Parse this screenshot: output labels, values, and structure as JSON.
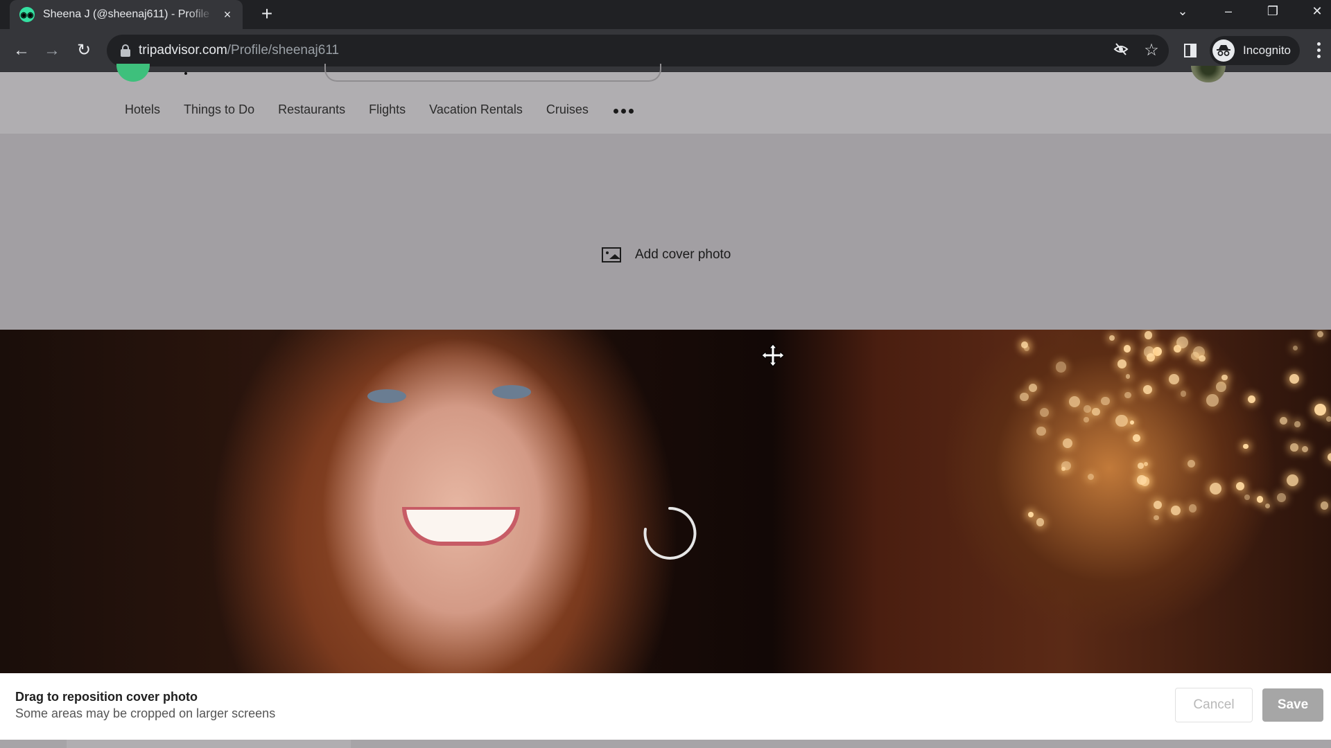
{
  "browser": {
    "tab": {
      "title": "Sheena J (@sheenaj611) - Profile",
      "favicon": "tripadvisor-owl-icon",
      "close_label": "×"
    },
    "new_tab_label": "+",
    "window_controls": {
      "tab_search": "⌄",
      "minimize": "–",
      "restore": "❐",
      "close": "✕"
    },
    "nav": {
      "back": "←",
      "forward": "→",
      "reload": "↻"
    },
    "url": {
      "domain": "tripadvisor.com",
      "path": "/Profile/sheenaj611"
    },
    "omnibox_icons": {
      "tracking_protection": "eye-off-icon",
      "bookmark": "☆"
    },
    "incognito_label": "Incognito"
  },
  "site": {
    "nav_links": [
      {
        "label": "Hotels"
      },
      {
        "label": "Things to Do"
      },
      {
        "label": "Restaurants"
      },
      {
        "label": "Flights"
      },
      {
        "label": "Vacation Rentals"
      },
      {
        "label": "Cruises"
      }
    ],
    "more_label": "More"
  },
  "cover": {
    "add_cover_label": "Add cover photo"
  },
  "reposition": {
    "title": "Drag to reposition cover photo",
    "subtitle": "Some areas may be cropped on larger screens",
    "cancel_label": "Cancel",
    "save_label": "Save"
  },
  "colors": {
    "brand_green": "#34e0a1",
    "chrome_dark": "#202124",
    "chrome_toolbar": "#35363a",
    "save_disabled": "#a6a6a6"
  }
}
